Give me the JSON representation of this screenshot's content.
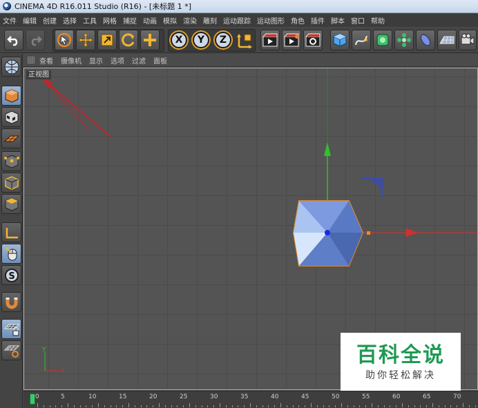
{
  "window": {
    "title": "CINEMA 4D R16.011 Studio (R16) - [未标题 1 *]"
  },
  "menubar": {
    "items": [
      "文件",
      "编辑",
      "创建",
      "选择",
      "工具",
      "网格",
      "捕捉",
      "动画",
      "模拟",
      "渲染",
      "雕刻",
      "运动跟踪",
      "运动图形",
      "角色",
      "插件",
      "脚本",
      "窗口",
      "帮助"
    ]
  },
  "toolbar": {
    "axis_x": "X",
    "axis_y": "Y",
    "axis_z": "Z"
  },
  "viewport": {
    "menu": [
      "查看",
      "摄像机",
      "显示",
      "选项",
      "过滤",
      "面板"
    ],
    "label": "正视图",
    "axis_x_label": "X",
    "axis_y_label": "Y",
    "annotation_color": "#c0262c",
    "axis_colors": {
      "x": "#d03030",
      "y": "#30c030"
    },
    "object_color": "#6e8fd6",
    "object_outline_color": "#e08a2a"
  },
  "timeline": {
    "ticks": [
      "0",
      "5",
      "10",
      "15",
      "20",
      "25",
      "30",
      "35",
      "40",
      "45",
      "50",
      "55",
      "60",
      "65",
      "70"
    ],
    "current_frame": "0"
  },
  "watermark": {
    "main": "百科全说",
    "sub": "助你轻松解决"
  },
  "icons": {
    "undo": "undo-icon",
    "redo": "redo-icon",
    "select": "live-selection-icon",
    "move": "move-icon",
    "scale": "scale-icon",
    "rotate": "rotate-icon",
    "add": "add-icon",
    "world": "coordinate-system-icon",
    "render_view": "render-view-icon",
    "render_picture": "render-picture-viewer-icon",
    "render_settings": "render-settings-icon",
    "cube": "cube-icon",
    "spline_pen": "spline-pen-icon",
    "subdivision": "subdivision-surface-icon",
    "array": "array-icon",
    "deformer": "deformer-icon",
    "floor": "floor-icon",
    "camera": "camera-icon"
  }
}
